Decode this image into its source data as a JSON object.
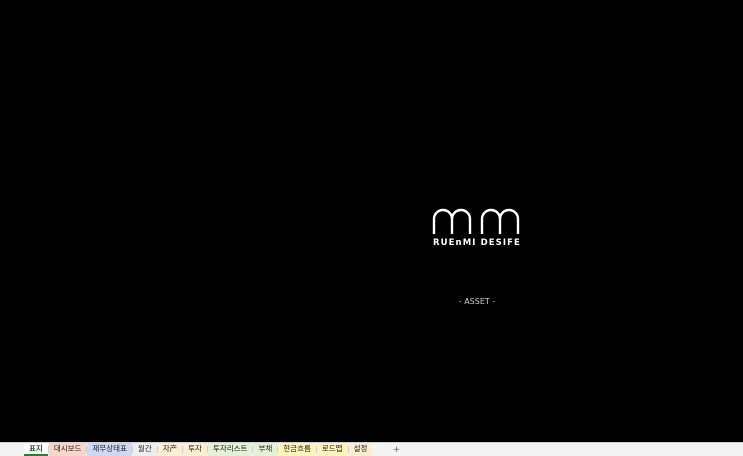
{
  "canvas": {
    "logo_text": "RUEnMI DESIFE",
    "asset_label": "- ASSET -"
  },
  "tabs": [
    {
      "label": "표지",
      "active": true,
      "color": "#ffffff"
    },
    {
      "label": "대시보드",
      "active": false,
      "color": "#f8d7c8"
    },
    {
      "label": "재무상태표",
      "active": false,
      "color": "#cfd8f3"
    },
    {
      "label": "월간",
      "active": false,
      "color": "#eeeeee"
    },
    {
      "label": "자产",
      "active": false,
      "color": "#fdeed1"
    },
    {
      "label": "투자",
      "active": false,
      "color": "#fdeed1"
    },
    {
      "label": "투자리스트",
      "active": false,
      "color": "#e4f1d7"
    },
    {
      "label": "부채",
      "active": false,
      "color": "#e4f1d7"
    },
    {
      "label": "현금흐름",
      "active": false,
      "color": "#fff3b8"
    },
    {
      "label": "로드맵",
      "active": false,
      "color": "#fff3b8"
    },
    {
      "label": "설정",
      "active": false,
      "color": "#fdeed1"
    }
  ],
  "add_sheet_icon": "plus-icon",
  "add_sheet_glyph": "+"
}
